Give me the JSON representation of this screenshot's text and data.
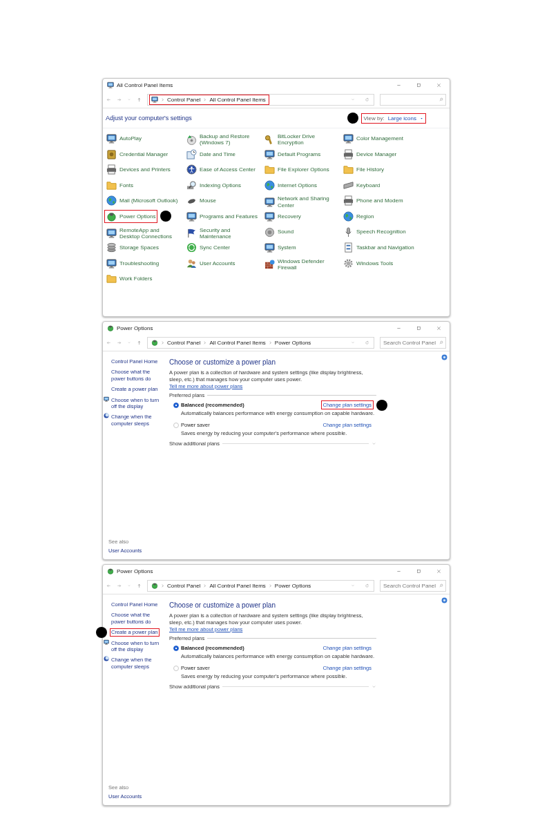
{
  "windows": [
    {
      "kind": "control_panel",
      "title": "All Control Panel Items",
      "address": {
        "crumbs": [
          "Control Panel",
          "All Control Panel Items"
        ],
        "highlighted": true
      },
      "heading": "Adjust your computer's settings",
      "view_by": {
        "label": "View by:",
        "value": "Large icons",
        "highlighted": true
      },
      "items": [
        {
          "label": "AutoPlay",
          "highlighted": false
        },
        {
          "label": "Backup and Restore (Windows 7)",
          "highlighted": false
        },
        {
          "label": "BitLocker Drive Encryption",
          "highlighted": false
        },
        {
          "label": "Color Management",
          "highlighted": false
        },
        {
          "label": "Credential Manager",
          "highlighted": false
        },
        {
          "label": "Date and Time",
          "highlighted": false
        },
        {
          "label": "Default Programs",
          "highlighted": false
        },
        {
          "label": "Device Manager",
          "highlighted": false
        },
        {
          "label": "Devices and Printers",
          "highlighted": false
        },
        {
          "label": "Ease of Access Center",
          "highlighted": false
        },
        {
          "label": "File Explorer Options",
          "highlighted": false
        },
        {
          "label": "File History",
          "highlighted": false
        },
        {
          "label": "Fonts",
          "highlighted": false
        },
        {
          "label": "Indexing Options",
          "highlighted": false
        },
        {
          "label": "Internet Options",
          "highlighted": false
        },
        {
          "label": "Keyboard",
          "highlighted": false
        },
        {
          "label": "Mail (Microsoft Outlook)",
          "highlighted": false
        },
        {
          "label": "Mouse",
          "highlighted": false
        },
        {
          "label": "Network and Sharing Center",
          "highlighted": false
        },
        {
          "label": "Phone and Modem",
          "highlighted": false
        },
        {
          "label": "Power Options",
          "highlighted": true
        },
        {
          "label": "Programs and Features",
          "highlighted": false
        },
        {
          "label": "Recovery",
          "highlighted": false
        },
        {
          "label": "Region",
          "highlighted": false
        },
        {
          "label": "RemoteApp and Desktop Connections",
          "highlighted": false
        },
        {
          "label": "Security and Maintenance",
          "highlighted": false
        },
        {
          "label": "Sound",
          "highlighted": false
        },
        {
          "label": "Speech Recognition",
          "highlighted": false
        },
        {
          "label": "Storage Spaces",
          "highlighted": false
        },
        {
          "label": "Sync Center",
          "highlighted": false
        },
        {
          "label": "System",
          "highlighted": false
        },
        {
          "label": "Taskbar and Navigation",
          "highlighted": false
        },
        {
          "label": "Troubleshooting",
          "highlighted": false
        },
        {
          "label": "User Accounts",
          "highlighted": false
        },
        {
          "label": "Windows Defender Firewall",
          "highlighted": false
        },
        {
          "label": "Windows Tools",
          "highlighted": false
        },
        {
          "label": "Work Folders",
          "highlighted": false
        }
      ]
    },
    {
      "kind": "power_options",
      "title": "Power Options",
      "address": {
        "crumbs": [
          "Control Panel",
          "All Control Panel Items",
          "Power Options"
        ],
        "highlighted": false
      },
      "search_placeholder": "Search Control Panel",
      "sidebar": [
        {
          "label": "Control Panel Home",
          "highlighted": false
        },
        {
          "label": "Choose what the power buttons do",
          "highlighted": false
        },
        {
          "label": "Create a power plan",
          "highlighted": false
        },
        {
          "label": "Choose when to turn off the display",
          "highlighted": false
        },
        {
          "label": "Change when the computer sleeps",
          "highlighted": false
        }
      ],
      "see_also": {
        "label": "See also",
        "links": [
          "User Accounts"
        ]
      },
      "heading": "Choose or customize a power plan",
      "description": "A power plan is a collection of hardware and system settings (like display brightness, sleep, etc.) that manages how your computer uses power.",
      "more_link": "Tell me more about power plans",
      "group_label": "Preferred plans",
      "plans": [
        {
          "name": "Balanced (recommended)",
          "selected": true,
          "description": "Automatically balances performance with energy consumption on capable hardware.",
          "settings_link": {
            "label": "Change plan settings",
            "highlighted": true
          }
        },
        {
          "name": "Power saver",
          "selected": false,
          "description": "Saves energy by reducing your computer's performance where possible.",
          "settings_link": {
            "label": "Change plan settings",
            "highlighted": false
          }
        }
      ],
      "additional_plans": "Show additional plans"
    },
    {
      "kind": "power_options",
      "title": "Power Options",
      "address": {
        "crumbs": [
          "Control Panel",
          "All Control Panel Items",
          "Power Options"
        ],
        "highlighted": false
      },
      "search_placeholder": "Search Control Panel",
      "sidebar": [
        {
          "label": "Control Panel Home",
          "highlighted": false
        },
        {
          "label": "Choose what the power buttons do",
          "highlighted": false
        },
        {
          "label": "Create a power plan",
          "highlighted": true
        },
        {
          "label": "Choose when to turn off the display",
          "highlighted": false
        },
        {
          "label": "Change when the computer sleeps",
          "highlighted": false
        }
      ],
      "see_also": {
        "label": "See also",
        "links": [
          "User Accounts"
        ]
      },
      "heading": "Choose or customize a power plan",
      "description": "A power plan is a collection of hardware and system settings (like display brightness, sleep, etc.) that manages how your computer uses power.",
      "more_link": "Tell me more about power plans",
      "group_label": "Preferred plans",
      "plans": [
        {
          "name": "Balanced (recommended)",
          "selected": true,
          "description": "Automatically balances performance with energy consumption on capable hardware.",
          "settings_link": {
            "label": "Change plan settings",
            "highlighted": false
          }
        },
        {
          "name": "Power saver",
          "selected": false,
          "description": "Saves energy by reducing your computer's performance where possible.",
          "settings_link": {
            "label": "Change plan settings",
            "highlighted": false
          }
        }
      ],
      "additional_plans": "Show additional plans"
    }
  ]
}
